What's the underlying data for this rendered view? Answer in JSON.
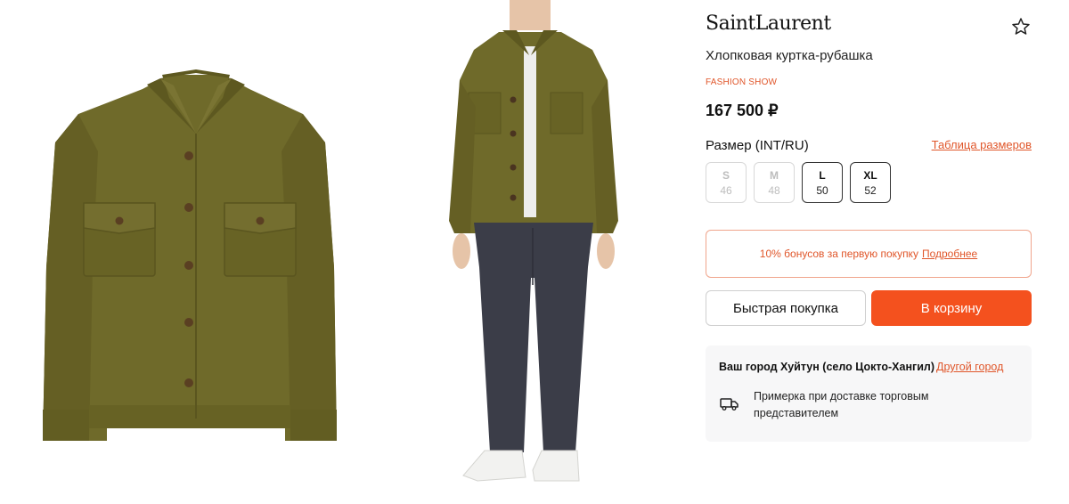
{
  "product": {
    "brand": "SaintLaurent",
    "title": "Хлопковая куртка-рубашка",
    "tag": "FASHION SHOW",
    "price": "167 500 ₽"
  },
  "images": [
    {
      "name": "jacket-flat-photo"
    },
    {
      "name": "model-photo"
    }
  ],
  "size_selector": {
    "label": "Размер (INT/RU)",
    "table_link": "Таблица размеров",
    "sizes": [
      {
        "int": "S",
        "ru": "46",
        "available": false
      },
      {
        "int": "M",
        "ru": "48",
        "available": false
      },
      {
        "int": "L",
        "ru": "50",
        "available": true
      },
      {
        "int": "XL",
        "ru": "52",
        "available": true
      }
    ]
  },
  "bonus": {
    "text": "10% бонусов за первую покупку",
    "link": "Подробнее"
  },
  "actions": {
    "quick_buy": "Быстрая покупка",
    "add_to_cart": "В корзину"
  },
  "delivery": {
    "city": "Ваш город Хуйтун (село Цокто-Хангил)",
    "change_city": "Другой город",
    "fitting_text": "Примерка при доставке торговым представителем"
  },
  "icons": {
    "favorite": "star-outline-icon",
    "delivery": "truck-icon"
  },
  "colors": {
    "accent": "#f4511e",
    "accent_text": "#e0562a",
    "jacket": "#6f6a2a",
    "jeans": "#3b3d48"
  }
}
